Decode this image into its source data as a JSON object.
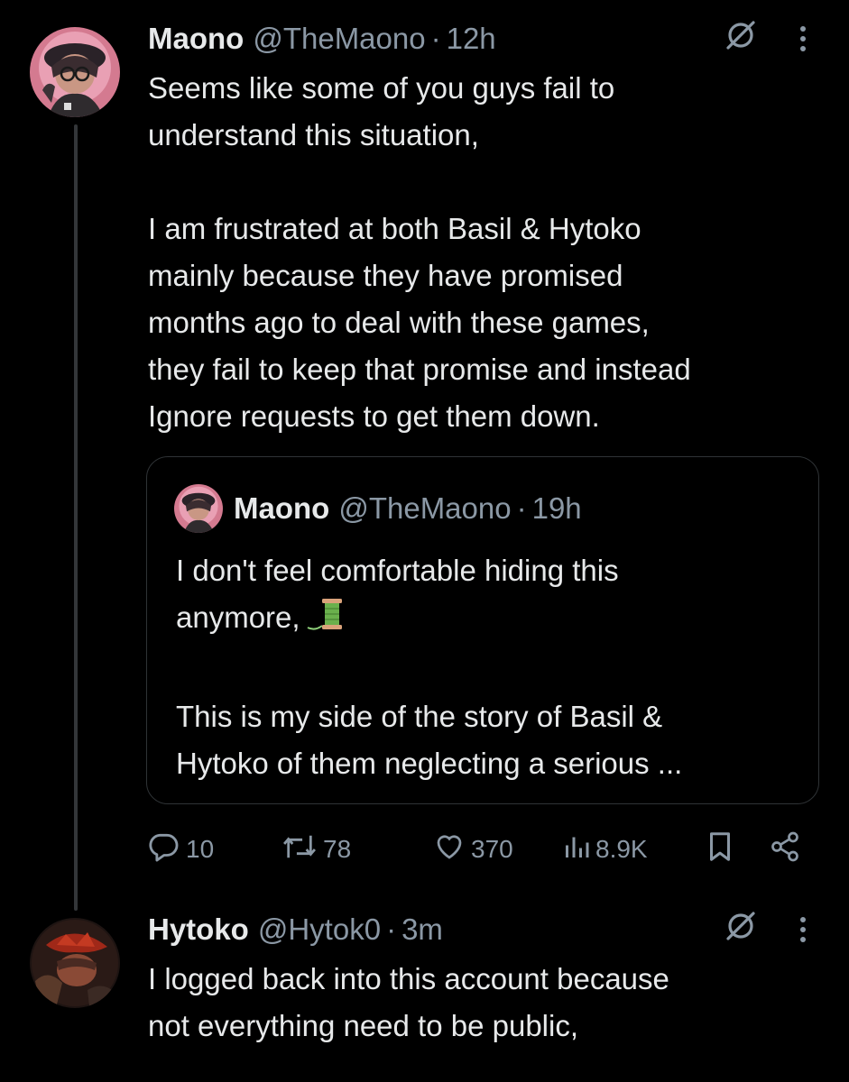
{
  "thread": [
    {
      "name": "Maono",
      "handle": "@TheMaono",
      "separator": "·",
      "time": "12h",
      "text": "Seems like some of you guys fail to\nunderstand this situation,\n\nI am frustrated at both Basil & Hytoko\nmainly because they have promised\nmonths ago to deal with these games,\nthey fail to keep that promise and instead\nIgnore requests to get them down.",
      "quote": {
        "name": "Maono",
        "handle": "@TheMaono",
        "separator": "·",
        "time": "19h",
        "text_line1": "I don't feel comfortable hiding this",
        "text_line2": "anymore,",
        "text_rest": "This is my side of the story of Basil &\nHytoko of them neglecting a serious ...",
        "emoji": "spool-of-thread"
      },
      "stats": {
        "replies": "10",
        "retweets": "78",
        "likes": "370",
        "views": "8.9K"
      }
    },
    {
      "name": "Hytoko",
      "handle": "@Hytok0",
      "separator": "·",
      "time": "3m",
      "text": "I logged back into this account because\nnot everything need to be public,"
    }
  ],
  "colors": {
    "background": "#000000",
    "text_primary": "#e7e9ea",
    "text_secondary": "#8b98a5",
    "border": "#2f3336"
  }
}
